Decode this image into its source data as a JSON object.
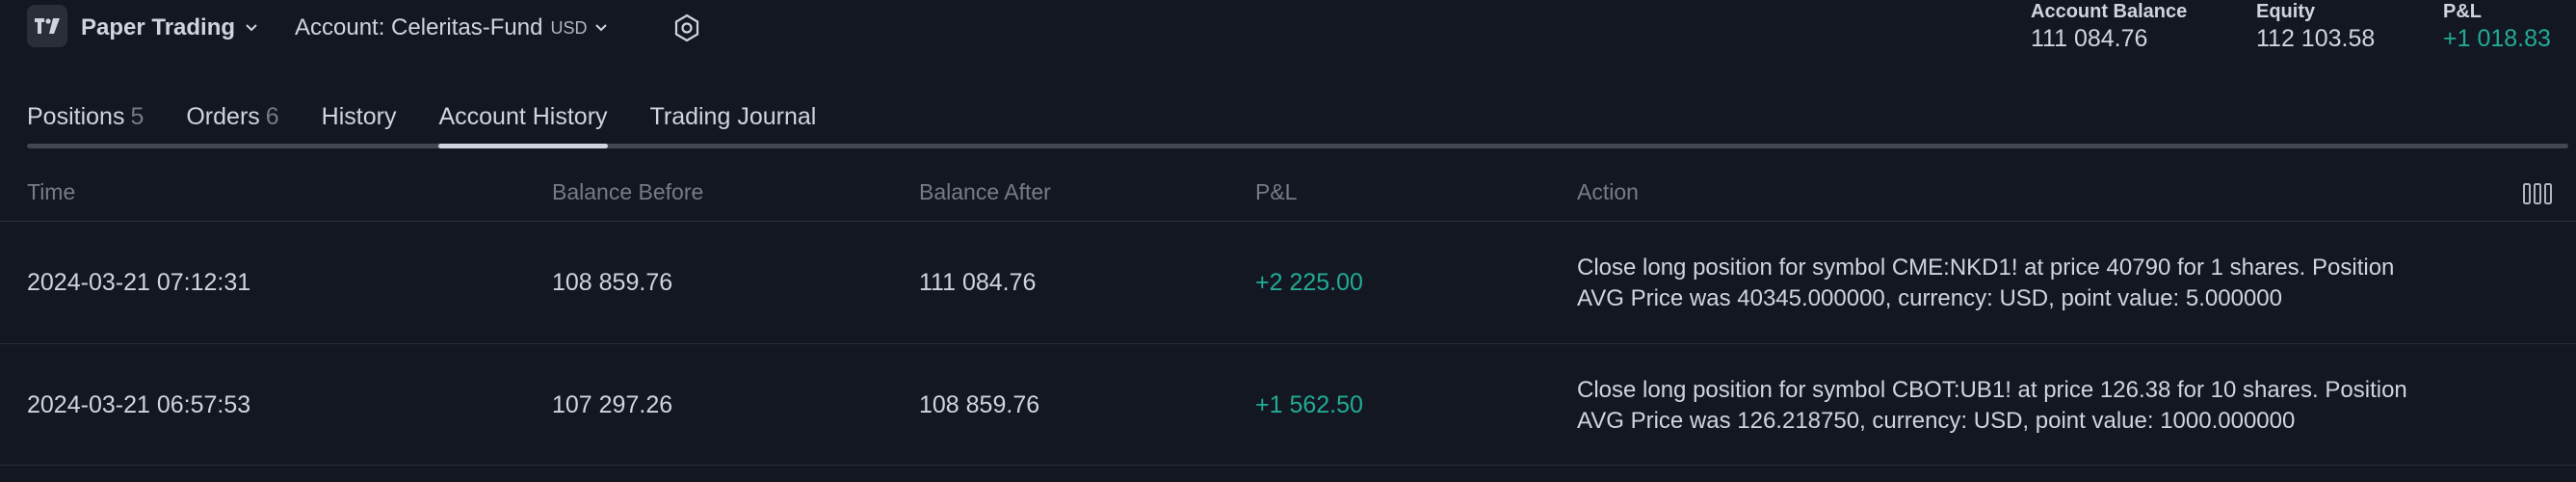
{
  "header": {
    "broker_label": "Paper Trading",
    "account_label": "Account: Celeritas-Fund",
    "account_currency": "USD"
  },
  "metrics": {
    "account_balance": {
      "label": "Account Balance",
      "value": "111 084.76"
    },
    "equity": {
      "label": "Equity",
      "value": "112 103.58"
    },
    "pnl": {
      "label": "P&L",
      "value": "+1 018.83"
    }
  },
  "tabs": [
    {
      "label": "Positions",
      "count": "5"
    },
    {
      "label": "Orders",
      "count": "6"
    },
    {
      "label": "History",
      "count": ""
    },
    {
      "label": "Account History",
      "count": ""
    },
    {
      "label": "Trading Journal",
      "count": ""
    }
  ],
  "active_tab": "Account History",
  "table": {
    "columns": [
      "Time",
      "Balance Before",
      "Balance After",
      "P&L",
      "Action"
    ],
    "rows": [
      {
        "time": "2024-03-21 07:12:31",
        "balance_before": "108 859.76",
        "balance_after": "111 084.76",
        "pnl": "+2 225.00",
        "action": "Close long position for symbol CME:NKD1! at price 40790 for 1 shares. Position AVG Price was 40345.000000, currency: USD, point value: 5.000000"
      },
      {
        "time": "2024-03-21 06:57:53",
        "balance_before": "107 297.26",
        "balance_after": "108 859.76",
        "pnl": "+1 562.50",
        "action": "Close long position for symbol CBOT:UB1! at price 126.38 for 10 shares. Position AVG Price was 126.218750, currency: USD, point value: 1000.000000"
      }
    ]
  },
  "colors": {
    "background": "#131722",
    "positive": "#22ab94",
    "text": "#d1d4dc",
    "muted": "#787b86"
  },
  "icons": [
    "tradingview-logo-icon",
    "chevron-down-icon",
    "settings-hexagon-icon",
    "columns-icon"
  ]
}
